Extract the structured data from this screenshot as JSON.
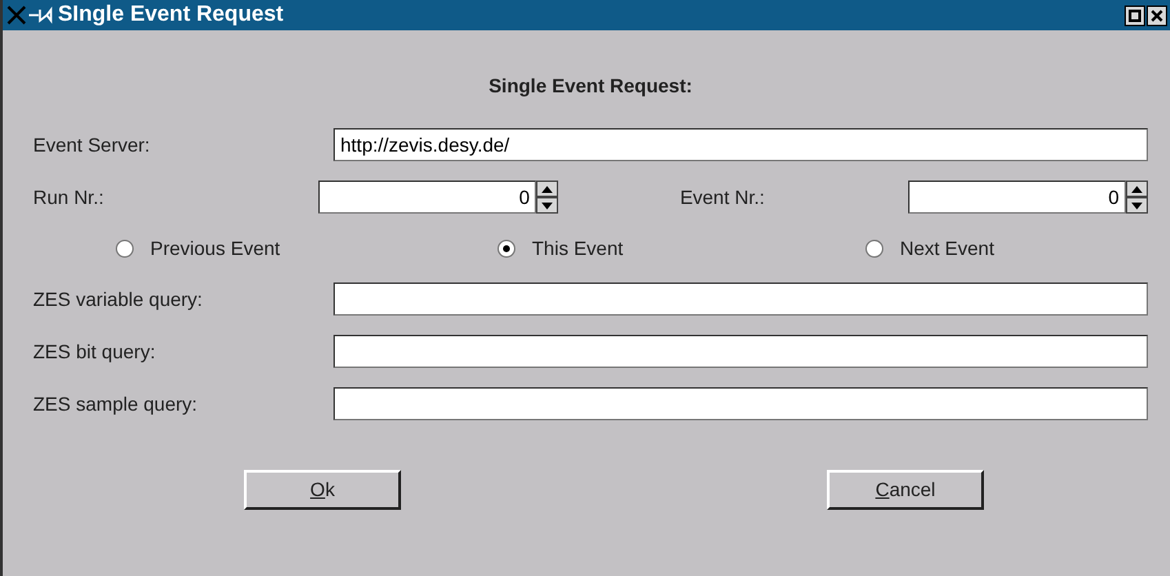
{
  "window": {
    "title": "SIngle Event Request",
    "buttons": [
      {
        "kind": "maximize"
      },
      {
        "kind": "close"
      }
    ]
  },
  "heading": "Single Event Request:",
  "event_server": {
    "label": "Event Server:",
    "value": "http://zevis.desy.de/"
  },
  "run_nr": {
    "label": "Run Nr.:",
    "value": "0"
  },
  "event_nr": {
    "label": "Event Nr.:",
    "value": "0"
  },
  "event_choice": [
    {
      "label": "Previous Event",
      "selected": false
    },
    {
      "label": "This Event",
      "selected": true
    },
    {
      "label": "Next Event",
      "selected": false
    }
  ],
  "queries": [
    {
      "label": "ZES variable query:"
    },
    {
      "label": "ZES bit query:"
    },
    {
      "label": "ZES sample query:"
    }
  ],
  "buttons": [
    {
      "label": "Ok",
      "mnemonic_underlined": true
    },
    {
      "label": "Cancel",
      "mnemonic_underlined": true
    }
  ]
}
